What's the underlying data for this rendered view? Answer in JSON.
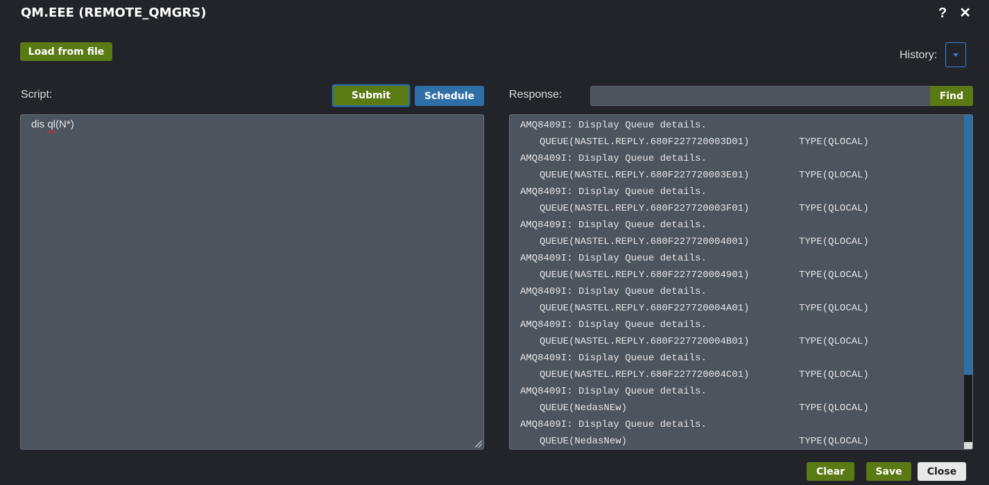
{
  "window": {
    "title": "QM.EEE (REMOTE_QMGRS)",
    "help_icon": "?",
    "close_icon": "✕"
  },
  "toolbar": {
    "load_label": "Load from file",
    "history_label": "History:"
  },
  "script": {
    "label": "Script:",
    "submit_label": "Submit",
    "schedule_label": "Schedule",
    "prefix": "dis ",
    "misspelled": "ql",
    "suffix": "(N*)"
  },
  "response": {
    "label": "Response:",
    "find_label": "Find",
    "find_value": "",
    "lines": [
      {
        "header": "AMQ8409I: Display Queue details.",
        "queue": "QUEUE(NASTEL.REPLY.680F227720003D01)",
        "type": "TYPE(QLOCAL)"
      },
      {
        "header": "AMQ8409I: Display Queue details.",
        "queue": "QUEUE(NASTEL.REPLY.680F227720003E01)",
        "type": "TYPE(QLOCAL)"
      },
      {
        "header": "AMQ8409I: Display Queue details.",
        "queue": "QUEUE(NASTEL.REPLY.680F227720003F01)",
        "type": "TYPE(QLOCAL)"
      },
      {
        "header": "AMQ8409I: Display Queue details.",
        "queue": "QUEUE(NASTEL.REPLY.680F227720004001)",
        "type": "TYPE(QLOCAL)"
      },
      {
        "header": "AMQ8409I: Display Queue details.",
        "queue": "QUEUE(NASTEL.REPLY.680F227720004901)",
        "type": "TYPE(QLOCAL)"
      },
      {
        "header": "AMQ8409I: Display Queue details.",
        "queue": "QUEUE(NASTEL.REPLY.680F227720004A01)",
        "type": "TYPE(QLOCAL)"
      },
      {
        "header": "AMQ8409I: Display Queue details.",
        "queue": "QUEUE(NASTEL.REPLY.680F227720004B01)",
        "type": "TYPE(QLOCAL)"
      },
      {
        "header": "AMQ8409I: Display Queue details.",
        "queue": "QUEUE(NASTEL.REPLY.680F227720004C01)",
        "type": "TYPE(QLOCAL)"
      },
      {
        "header": "AMQ8409I: Display Queue details.",
        "queue": "QUEUE(NedasNEw)",
        "type": "TYPE(QLOCAL)"
      },
      {
        "header": "AMQ8409I: Display Queue details.",
        "queue": "QUEUE(NedasNew)",
        "type": "TYPE(QLOCAL)"
      }
    ]
  },
  "footer": {
    "clear_label": "Clear",
    "save_label": "Save",
    "close_label": "Close"
  },
  "colors": {
    "accent_green": "#5a7a14",
    "accent_blue": "#2f6fa8",
    "background": "#22242a",
    "panel": "#4c545e"
  }
}
